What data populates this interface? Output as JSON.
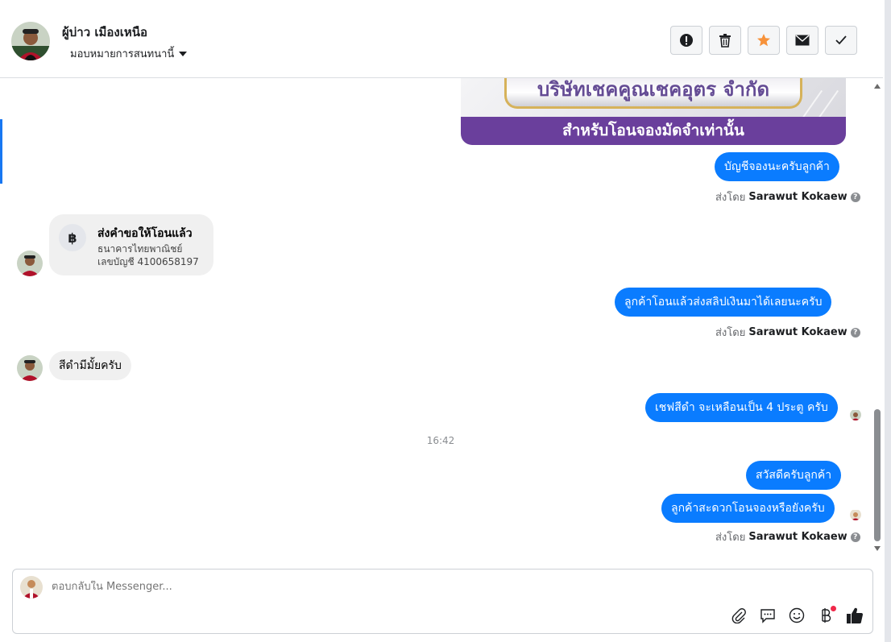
{
  "header": {
    "contact_name": "ผู้บ่าว เมืองเหนือ",
    "assign_label": "มอบหมายการสนทนานี้",
    "actions": [
      {
        "name": "spam-button",
        "icon": "exclamation-icon"
      },
      {
        "name": "delete-button",
        "icon": "trash-icon"
      },
      {
        "name": "star-button",
        "icon": "star-icon",
        "color": "#f7923a"
      },
      {
        "name": "mark-unread-button",
        "icon": "envelope-icon"
      },
      {
        "name": "done-button",
        "icon": "check-icon"
      }
    ]
  },
  "banner": {
    "top_text": "บริษัทเชคคูณเชคอุตร จำกัด",
    "bottom_text": "สำหรับโอนจองมัดจำเท่านั้น"
  },
  "messages": {
    "m1": "บัญชีจองนะครับลูกค้า",
    "m1_sender_prefix": "ส่งโดย",
    "m1_sender": "Sarawut Kokaew",
    "payment_card": {
      "icon": "฿",
      "title": "ส่งคำขอให้โอนแล้ว",
      "bank": "ธนาคารไทยพาณิชย์",
      "account": "เลขบัญชี 4100658197"
    },
    "m2": "ลูกค้าโอนแล้วส่งสลิปเงินมาได้เลยนะครับ",
    "m2_sender_prefix": "ส่งโดย",
    "m2_sender": "Sarawut Kokaew",
    "m3_incoming": "สีดำมีมั้ยครับ",
    "m4": "เชฟสีดำ จะเหลือนเป็น 4 ประตู ครับ",
    "timestamp": "16:42",
    "m5": "สวัสดีครับลูกค้า",
    "m6": "ลูกค้าสะดวกโอนจองหรือยังครับ",
    "m6_sender_prefix": "ส่งโดย",
    "m6_sender": "Sarawut Kokaew"
  },
  "composer": {
    "placeholder": "ตอบกลับใน Messenger..."
  },
  "colors": {
    "outgoing_bubble": "#0a7cff",
    "incoming_bubble": "#f0f0f0",
    "accent": "#1877f2"
  }
}
